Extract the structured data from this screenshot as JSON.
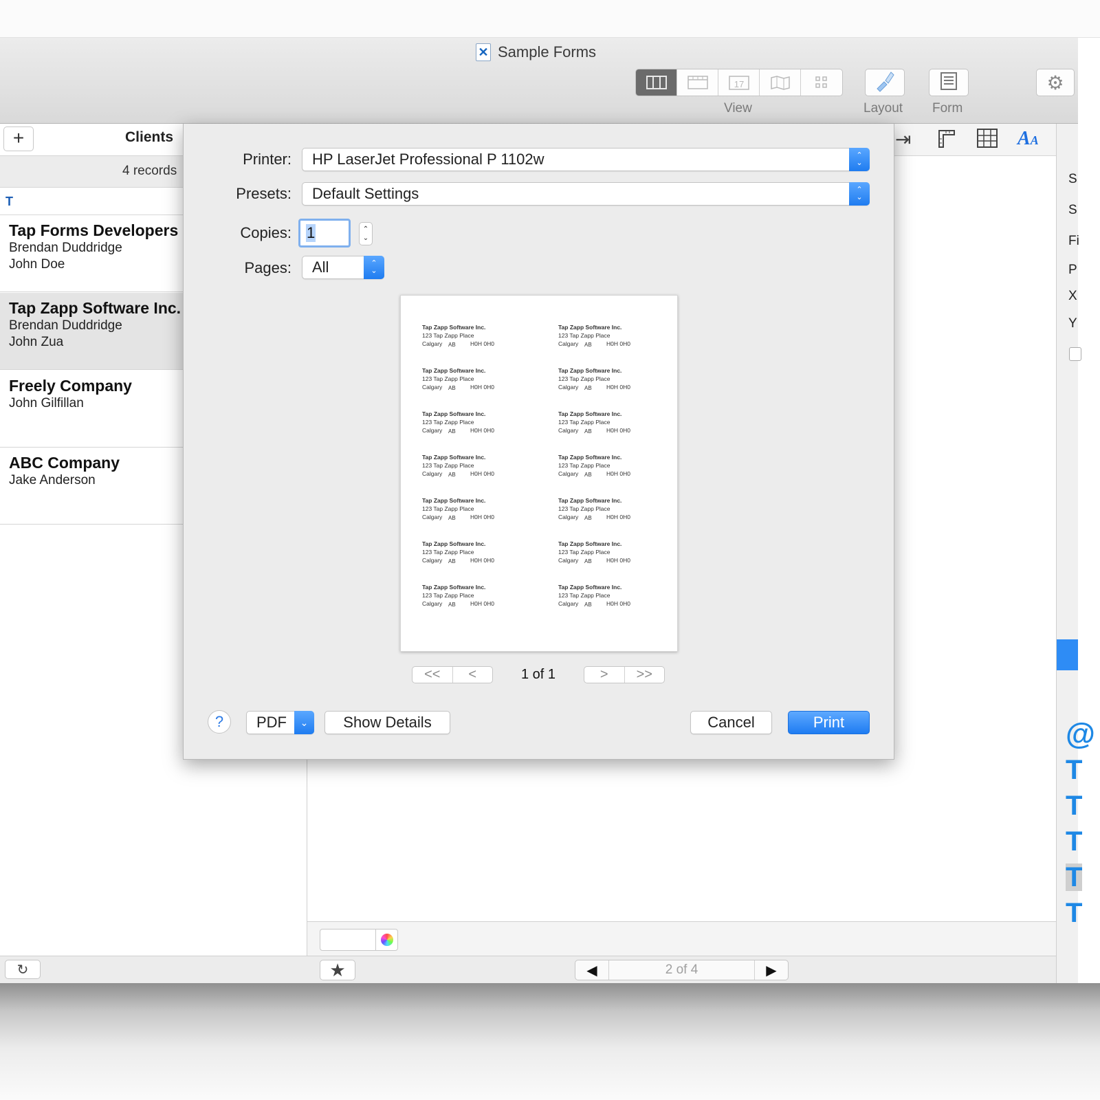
{
  "window": {
    "title": "Sample Forms"
  },
  "toolbar": {
    "view_label": "View",
    "layout_label": "Layout",
    "form_label": "Form"
  },
  "left_panel": {
    "add_label": "+",
    "title": "Clients",
    "records_count": "4 records",
    "section_letter": "T",
    "records": [
      {
        "name": "Tap Forms Developers",
        "lines": [
          "Brendan Duddridge",
          "John Doe"
        ]
      },
      {
        "name": "Tap Zapp Software Inc.",
        "lines": [
          "Brendan Duddridge",
          "John Zua"
        ],
        "selected": true
      },
      {
        "name": "Freely Company",
        "lines": [
          "John Gilfillan",
          ""
        ]
      },
      {
        "name": "ABC Company",
        "lines": [
          "Jake Anderson",
          ""
        ]
      }
    ]
  },
  "record_nav": {
    "prev": "◀",
    "position": "2 of 4",
    "next": "▶"
  },
  "inspector_letters": [
    "S",
    "S",
    "Fi",
    "P",
    "X",
    "Y"
  ],
  "print_dialog": {
    "printer_label": "Printer:",
    "printer_value": "HP LaserJet Professional P 1102w",
    "presets_label": "Presets:",
    "presets_value": "Default Settings",
    "copies_label": "Copies:",
    "copies_value": "1",
    "pages_label": "Pages:",
    "pages_value": "All",
    "preview_label": {
      "company": "Tap Zapp Software Inc.",
      "street": "123 Tap Zapp Place",
      "city": "Calgary",
      "state": "AB",
      "postal": "H0H 0H0"
    },
    "page_nav": {
      "first": "<<",
      "prev": "<",
      "position": "1 of 1",
      "next": ">",
      "last": ">>"
    },
    "help": "?",
    "pdf_label": "PDF",
    "show_details": "Show Details",
    "cancel": "Cancel",
    "print": "Print"
  },
  "colors": {
    "accent": "#2e8cf5",
    "section_letter": "#1d5fb5"
  }
}
